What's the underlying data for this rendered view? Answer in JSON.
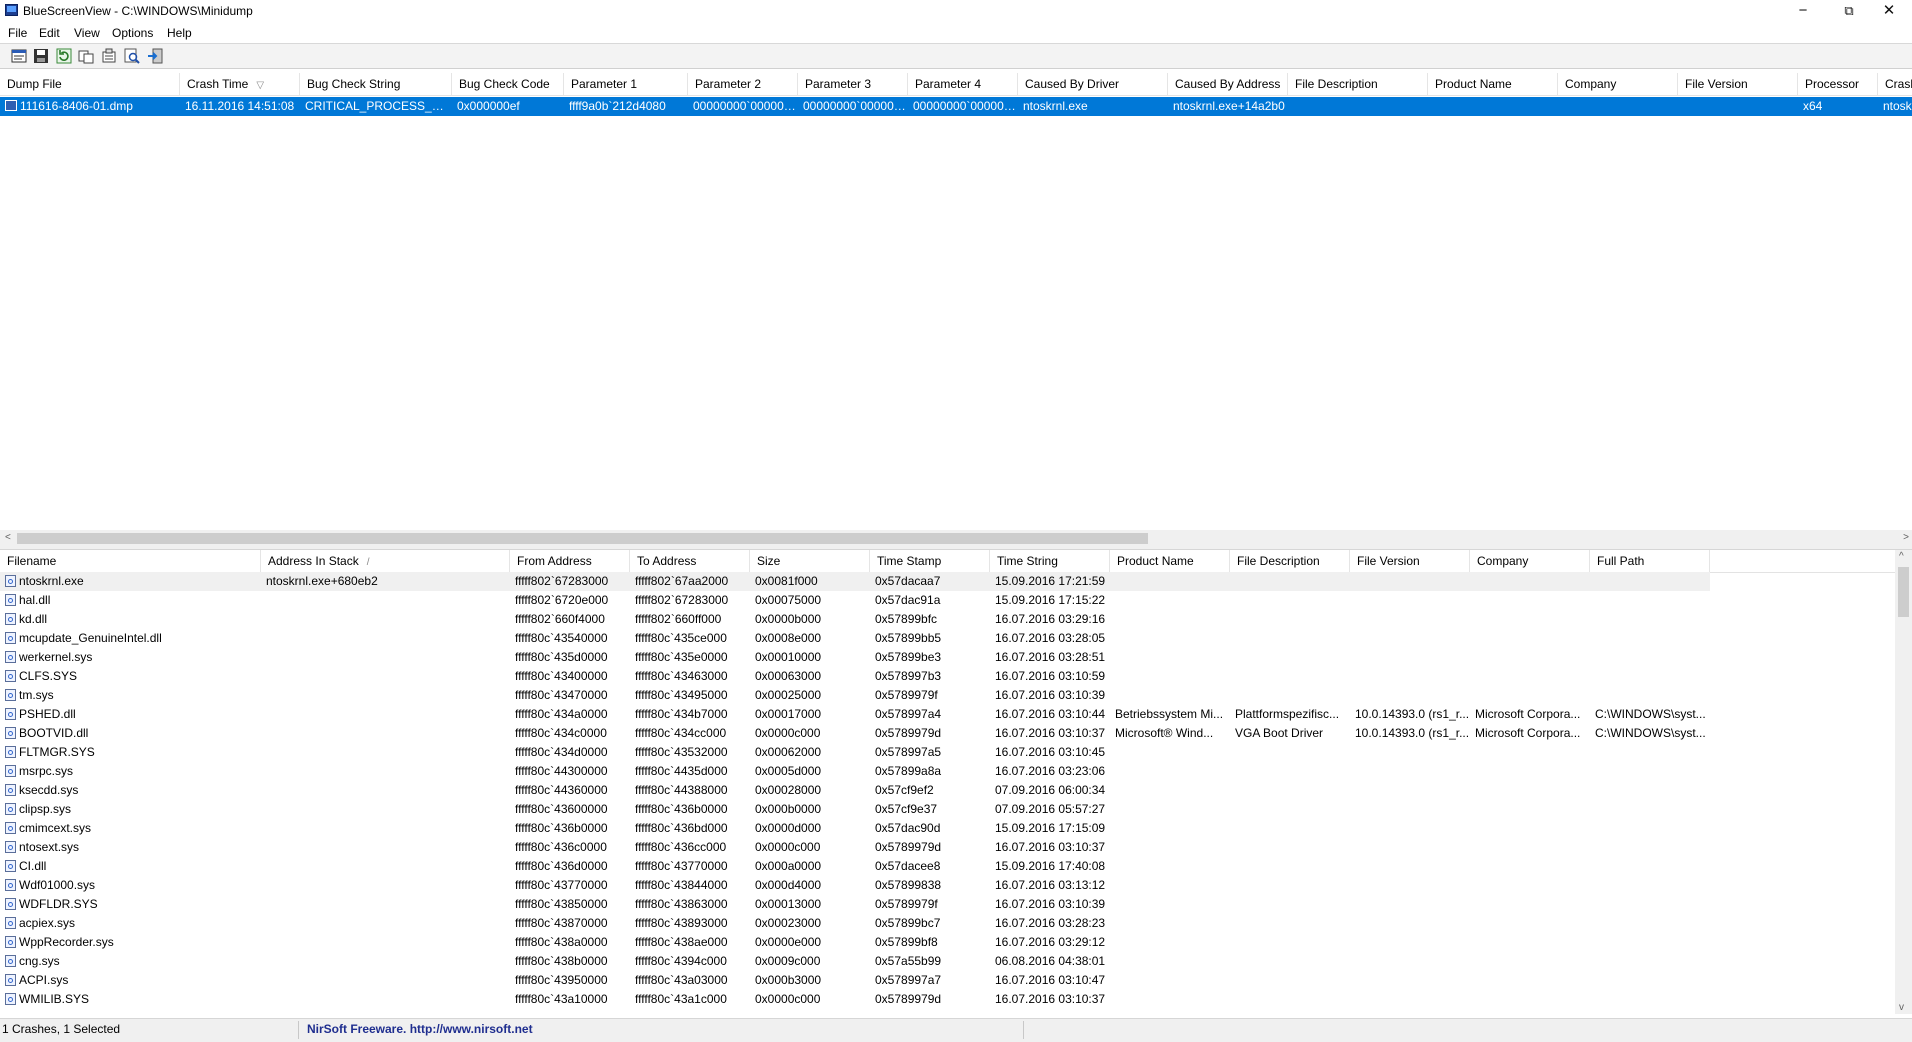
{
  "window": {
    "title": "BlueScreenView  -  C:\\WINDOWS\\Minidump",
    "controls": {
      "minimize": "−",
      "maximize": "⧉",
      "close": "✕"
    }
  },
  "menu": [
    "File",
    "Edit",
    "View",
    "Options",
    "Help"
  ],
  "toolbar": [
    "properties-icon",
    "save-icon",
    "refresh-icon",
    "copy-icon",
    "html-report-icon",
    "find-icon",
    "exit-icon"
  ],
  "dump_list": {
    "columns": [
      "Dump File",
      "Crash Time",
      "Bug Check String",
      "Bug Check Code",
      "Parameter 1",
      "Parameter 2",
      "Parameter 3",
      "Parameter 4",
      "Caused By Driver",
      "Caused By Address",
      "File Description",
      "Product Name",
      "Company",
      "File Version",
      "Processor",
      "Crash"
    ],
    "sort_mark": "▽",
    "rows": [
      [
        "111616-8406-01.dmp",
        "16.11.2016 14:51:08",
        "CRITICAL_PROCESS_DIED",
        "0x000000ef",
        "ffff9a0b`212d4080",
        "00000000`000000...",
        "00000000`000000...",
        "00000000`000000...",
        "ntoskrnl.exe",
        "ntoskrnl.exe+14a2b0",
        "",
        "",
        "",
        "",
        "x64",
        "ntosk"
      ]
    ]
  },
  "module_list": {
    "columns": [
      "Filename",
      "Address In Stack",
      "From Address",
      "To Address",
      "Size",
      "Time Stamp",
      "Time String",
      "Product Name",
      "File Description",
      "File Version",
      "Company",
      "Full Path"
    ],
    "sort_mark": "/",
    "rows": [
      [
        "ntoskrnl.exe",
        "ntoskrnl.exe+680eb2",
        "fffff802`67283000",
        "fffff802`67aa2000",
        "0x0081f000",
        "0x57dacaa7",
        "15.09.2016 17:21:59",
        "",
        "",
        "",
        "",
        ""
      ],
      [
        "hal.dll",
        "",
        "fffff802`6720e000",
        "fffff802`67283000",
        "0x00075000",
        "0x57dac91a",
        "15.09.2016 17:15:22",
        "",
        "",
        "",
        "",
        ""
      ],
      [
        "kd.dll",
        "",
        "fffff802`660f4000",
        "fffff802`660ff000",
        "0x0000b000",
        "0x57899bfc",
        "16.07.2016 03:29:16",
        "",
        "",
        "",
        "",
        ""
      ],
      [
        "mcupdate_GenuineIntel.dll",
        "",
        "fffff80c`43540000",
        "fffff80c`435ce000",
        "0x0008e000",
        "0x57899bb5",
        "16.07.2016 03:28:05",
        "",
        "",
        "",
        "",
        ""
      ],
      [
        "werkernel.sys",
        "",
        "fffff80c`435d0000",
        "fffff80c`435e0000",
        "0x00010000",
        "0x57899be3",
        "16.07.2016 03:28:51",
        "",
        "",
        "",
        "",
        ""
      ],
      [
        "CLFS.SYS",
        "",
        "fffff80c`43400000",
        "fffff80c`43463000",
        "0x00063000",
        "0x578997b3",
        "16.07.2016 03:10:59",
        "",
        "",
        "",
        "",
        ""
      ],
      [
        "tm.sys",
        "",
        "fffff80c`43470000",
        "fffff80c`43495000",
        "0x00025000",
        "0x5789979f",
        "16.07.2016 03:10:39",
        "",
        "",
        "",
        "",
        ""
      ],
      [
        "PSHED.dll",
        "",
        "fffff80c`434a0000",
        "fffff80c`434b7000",
        "0x00017000",
        "0x578997a4",
        "16.07.2016 03:10:44",
        "Betriebssystem Mi...",
        "Plattformspezifisc...",
        "10.0.14393.0 (rs1_r...",
        "Microsoft Corpora...",
        "C:\\WINDOWS\\syst..."
      ],
      [
        "BOOTVID.dll",
        "",
        "fffff80c`434c0000",
        "fffff80c`434cc000",
        "0x0000c000",
        "0x5789979d",
        "16.07.2016 03:10:37",
        "Microsoft® Wind...",
        "VGA Boot Driver",
        "10.0.14393.0 (rs1_r...",
        "Microsoft Corpora...",
        "C:\\WINDOWS\\syst..."
      ],
      [
        "FLTMGR.SYS",
        "",
        "fffff80c`434d0000",
        "fffff80c`43532000",
        "0x00062000",
        "0x578997a5",
        "16.07.2016 03:10:45",
        "",
        "",
        "",
        "",
        ""
      ],
      [
        "msrpc.sys",
        "",
        "fffff80c`44300000",
        "fffff80c`4435d000",
        "0x0005d000",
        "0x57899a8a",
        "16.07.2016 03:23:06",
        "",
        "",
        "",
        "",
        ""
      ],
      [
        "ksecdd.sys",
        "",
        "fffff80c`44360000",
        "fffff80c`44388000",
        "0x00028000",
        "0x57cf9ef2",
        "07.09.2016 06:00:34",
        "",
        "",
        "",
        "",
        ""
      ],
      [
        "clipsp.sys",
        "",
        "fffff80c`43600000",
        "fffff80c`436b0000",
        "0x000b0000",
        "0x57cf9e37",
        "07.09.2016 05:57:27",
        "",
        "",
        "",
        "",
        ""
      ],
      [
        "cmimcext.sys",
        "",
        "fffff80c`436b0000",
        "fffff80c`436bd000",
        "0x0000d000",
        "0x57dac90d",
        "15.09.2016 17:15:09",
        "",
        "",
        "",
        "",
        ""
      ],
      [
        "ntosext.sys",
        "",
        "fffff80c`436c0000",
        "fffff80c`436cc000",
        "0x0000c000",
        "0x5789979d",
        "16.07.2016 03:10:37",
        "",
        "",
        "",
        "",
        ""
      ],
      [
        "CI.dll",
        "",
        "fffff80c`436d0000",
        "fffff80c`43770000",
        "0x000a0000",
        "0x57dacee8",
        "15.09.2016 17:40:08",
        "",
        "",
        "",
        "",
        ""
      ],
      [
        "Wdf01000.sys",
        "",
        "fffff80c`43770000",
        "fffff80c`43844000",
        "0x000d4000",
        "0x57899838",
        "16.07.2016 03:13:12",
        "",
        "",
        "",
        "",
        ""
      ],
      [
        "WDFLDR.SYS",
        "",
        "fffff80c`43850000",
        "fffff80c`43863000",
        "0x00013000",
        "0x5789979f",
        "16.07.2016 03:10:39",
        "",
        "",
        "",
        "",
        ""
      ],
      [
        "acpiex.sys",
        "",
        "fffff80c`43870000",
        "fffff80c`43893000",
        "0x00023000",
        "0x57899bc7",
        "16.07.2016 03:28:23",
        "",
        "",
        "",
        "",
        ""
      ],
      [
        "WppRecorder.sys",
        "",
        "fffff80c`438a0000",
        "fffff80c`438ae000",
        "0x0000e000",
        "0x57899bf8",
        "16.07.2016 03:29:12",
        "",
        "",
        "",
        "",
        ""
      ],
      [
        "cng.sys",
        "",
        "fffff80c`438b0000",
        "fffff80c`4394c000",
        "0x0009c000",
        "0x57a55b99",
        "06.08.2016 04:38:01",
        "",
        "",
        "",
        "",
        ""
      ],
      [
        "ACPI.sys",
        "",
        "fffff80c`43950000",
        "fffff80c`43a03000",
        "0x000b3000",
        "0x578997a7",
        "16.07.2016 03:10:47",
        "",
        "",
        "",
        "",
        ""
      ],
      [
        "WMILIB.SYS",
        "",
        "fffff80c`43a10000",
        "fffff80c`43a1c000",
        "0x0000c000",
        "0x5789979d",
        "16.07.2016 03:10:37",
        "",
        "",
        "",
        "",
        ""
      ]
    ]
  },
  "status": {
    "count": "1 Crashes, 1 Selected",
    "freeware": "NirSoft Freeware.  http://www.nirsoft.net"
  }
}
